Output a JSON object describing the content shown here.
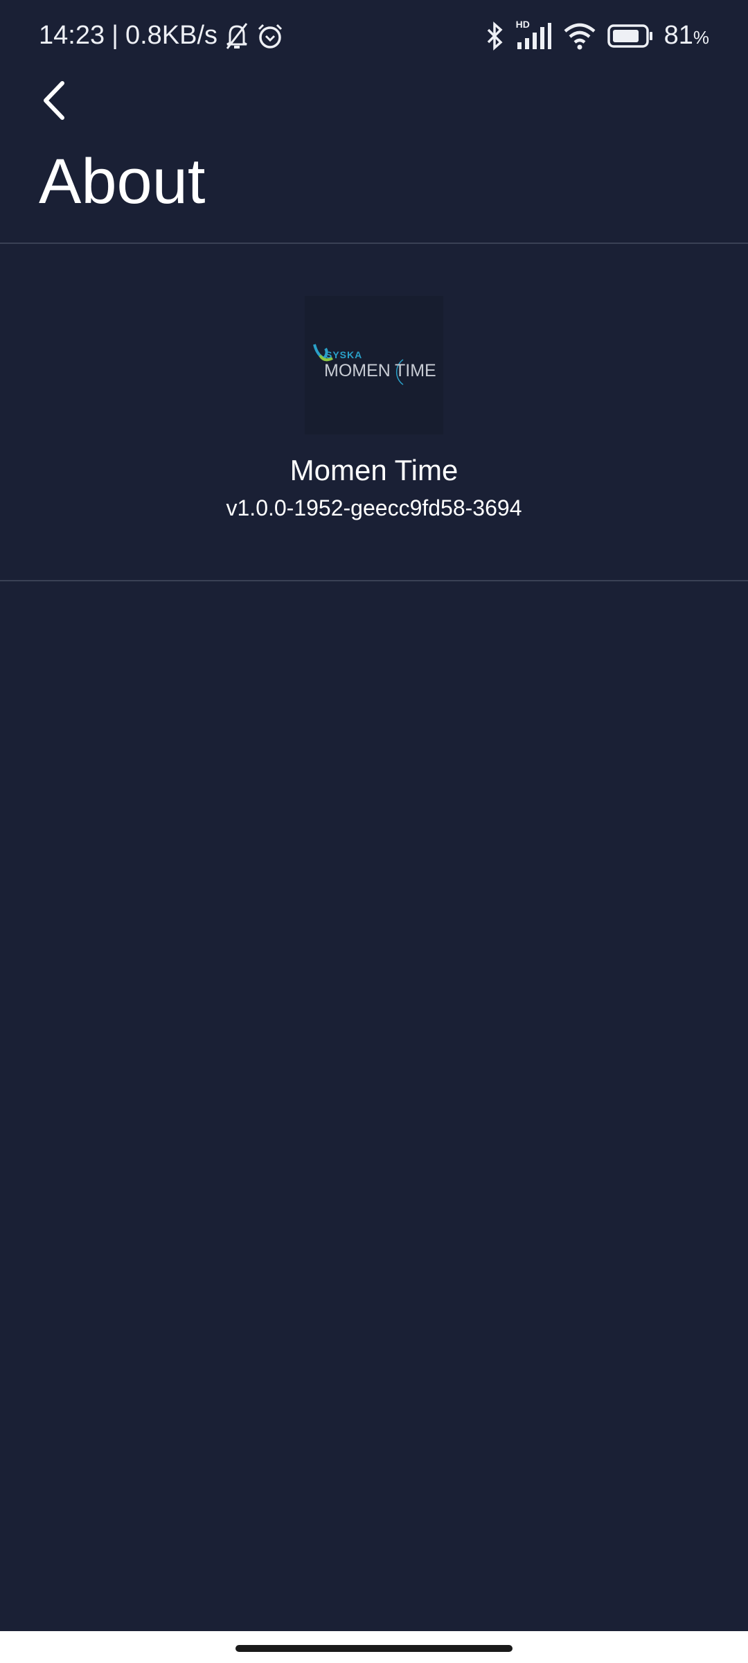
{
  "status_bar": {
    "time": "14:23",
    "network_speed": "0.8KB/s",
    "battery": "81",
    "battery_unit": "%",
    "battery_level": 81,
    "signal_label": "HD"
  },
  "header": {
    "title": "About"
  },
  "app": {
    "name": "Momen Time",
    "version": "v1.0.0-1952-geecc9fd58-3694",
    "logo_text_top": "SYSKA",
    "logo_text_left": "MOMEN",
    "logo_text_right": "TIME"
  },
  "colors": {
    "background": "#1a2035",
    "divider": "#3a4155",
    "logo_teal": "#2aa0c8",
    "logo_green": "#8cc63f"
  }
}
